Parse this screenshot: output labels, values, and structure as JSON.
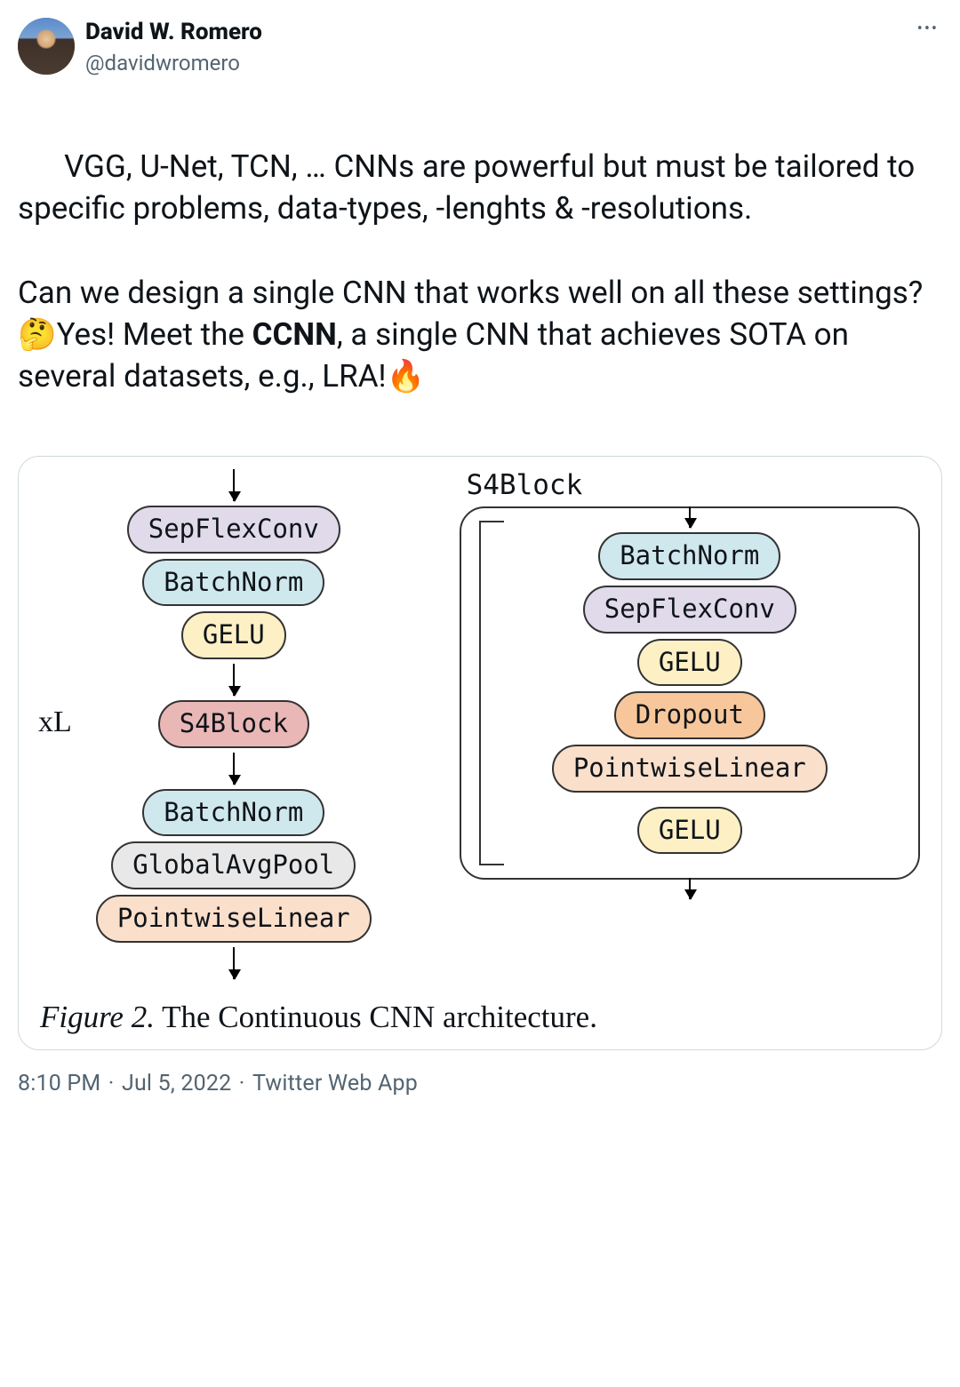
{
  "author": {
    "display_name": "David W. Romero",
    "handle": "@davidwromero"
  },
  "tweet": {
    "text_before_emoji1": "VGG, U-Net, TCN, … CNNs are powerful but must be tailored to specific problems, data-types, -lenghts & -resolutions.\n\nCan we design a single CNN that works well on all these settings?",
    "emoji1": "🤔",
    "text_mid1": "Yes! Meet the ",
    "bold": "CCNN",
    "text_mid2": ", a single CNN that achieves SOTA on several datasets, e.g., LRA!",
    "emoji2": "🔥"
  },
  "diagram": {
    "left": {
      "blocks": [
        {
          "label": "SepFlexConv",
          "color": "c-lavender"
        },
        {
          "label": "BatchNorm",
          "color": "c-blue"
        },
        {
          "label": "GELU",
          "color": "c-yellow"
        }
      ],
      "repeat_label": "xL",
      "repeat_block": {
        "label": "S4Block",
        "color": "c-pink"
      },
      "tail": [
        {
          "label": "BatchNorm",
          "color": "c-blue"
        },
        {
          "label": "GlobalAvgPool",
          "color": "c-grey"
        },
        {
          "label": "PointwiseLinear",
          "color": "c-peach"
        }
      ]
    },
    "right": {
      "title": "S4Block",
      "blocks": [
        {
          "label": "BatchNorm",
          "color": "c-blue"
        },
        {
          "label": "SepFlexConv",
          "color": "c-lavender"
        },
        {
          "label": "GELU",
          "color": "c-yellow"
        },
        {
          "label": "Dropout",
          "color": "c-orange"
        },
        {
          "label": "PointwiseLinear",
          "color": "c-peach"
        },
        {
          "label": "GELU",
          "color": "c-yellow"
        }
      ]
    },
    "caption_label": "Figure 2.",
    "caption_text": " The Continuous CNN architecture."
  },
  "meta": {
    "time": "8:10 PM",
    "date": "Jul 5, 2022",
    "source": "Twitter Web App"
  }
}
